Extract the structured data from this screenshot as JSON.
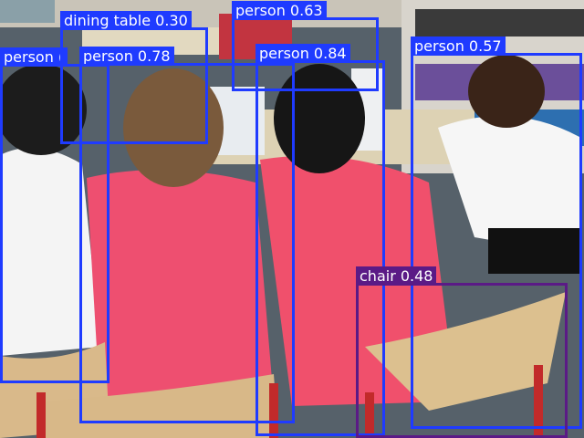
{
  "image": {
    "subject": "classroom-children-at-tables-with-laptops"
  },
  "colors": {
    "person": "#1f3bff",
    "dining_table": "#1f3bff",
    "chair": "#5b1a86"
  },
  "detections": [
    {
      "class": "person",
      "score": "0.84",
      "label": "person 0.84",
      "color": "#1f3bff"
    },
    {
      "class": "person",
      "score": "0.78",
      "label": "person 0.78",
      "color": "#1f3bff"
    },
    {
      "class": "person",
      "score": "0.63",
      "label": "person 0.63",
      "color": "#1f3bff"
    },
    {
      "class": "person",
      "score": "0.57",
      "label": "person 0.57",
      "color": "#1f3bff"
    },
    {
      "class": "person",
      "score": "",
      "label": "person (",
      "color": "#1f3bff"
    },
    {
      "class": "dining table",
      "score": "0.30",
      "label": "dining table 0.30",
      "color": "#1f3bff"
    },
    {
      "class": "chair",
      "score": "0.48",
      "label": "chair 0.48",
      "color": "#5b1a86"
    }
  ]
}
